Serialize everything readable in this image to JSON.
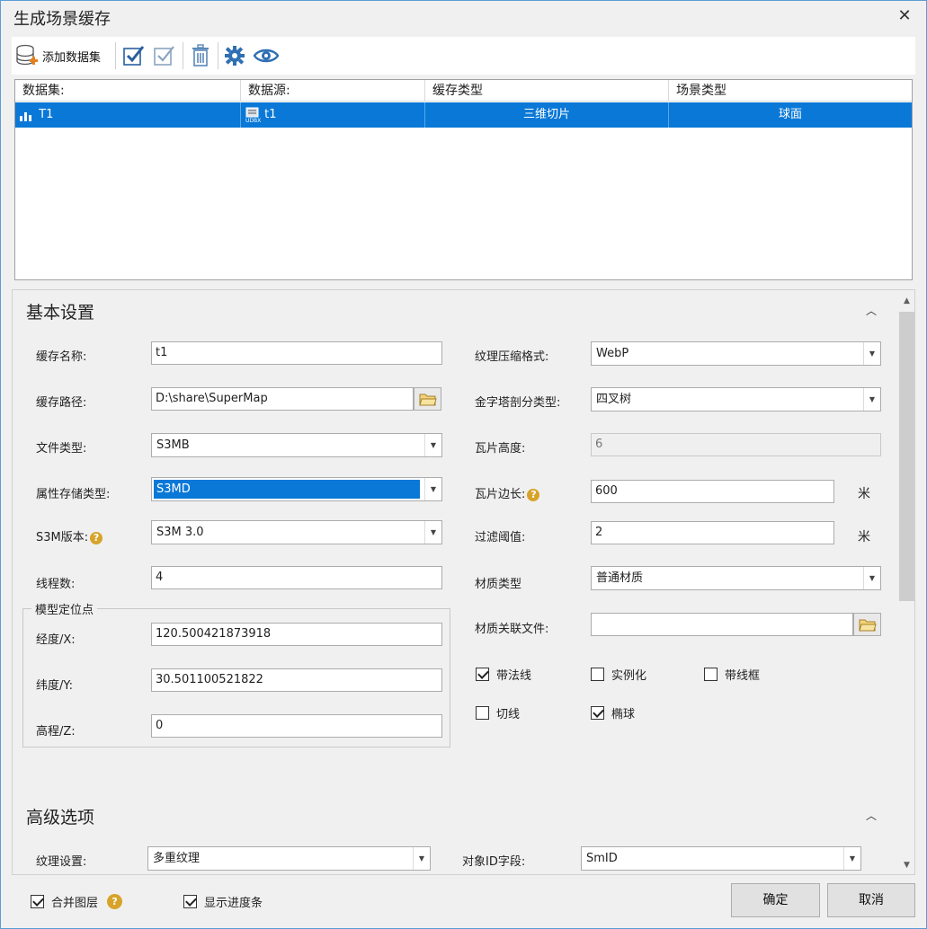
{
  "window": {
    "title": "生成场景缓存"
  },
  "toolbar": {
    "add_dataset_label": "添加数据集"
  },
  "grid": {
    "columns": [
      "数据集:",
      "数据源:",
      "缓存类型",
      "场景类型"
    ],
    "rows": [
      {
        "dataset": "T1",
        "datasource": "t1",
        "cache_type": "三维切片",
        "scene_type": "球面"
      }
    ]
  },
  "basic": {
    "title": "基本设置",
    "cache_name_label": "缓存名称:",
    "cache_name": "t1",
    "cache_path_label": "缓存路径:",
    "cache_path": "D:\\share\\SuperMap",
    "file_type_label": "文件类型:",
    "file_type": "S3MB",
    "attr_storage_label": "属性存储类型:",
    "attr_storage": "S3MD",
    "s3m_version_label": "S3M版本:",
    "s3m_version": "S3M 3.0",
    "threads_label": "线程数:",
    "threads": "4",
    "model_anchor": {
      "title": "模型定位点",
      "lon_label": "经度/X:",
      "lon": "120.500421873918",
      "lat_label": "纬度/Y:",
      "lat": "30.501100521822",
      "elev_label": "高程/Z:",
      "elev": "0"
    },
    "texture_compress_label": "纹理压缩格式:",
    "texture_compress": "WebP",
    "pyramid_label": "金字塔剖分类型:",
    "pyramid": "四叉树",
    "tile_height_label": "瓦片高度:",
    "tile_height": "6",
    "tile_edge_label": "瓦片边长:",
    "tile_edge": "600",
    "filter_label": "过滤阈值:",
    "filter": "2",
    "unit_m": "米",
    "material_type_label": "材质类型",
    "material_type": "普通材质",
    "material_file_label": "材质关联文件:",
    "material_file": "",
    "checks": {
      "normals": "带法线",
      "instancing": "实例化",
      "wireframe": "带线框",
      "tangent": "切线",
      "ellipsoid": "椭球"
    }
  },
  "advanced": {
    "title": "高级选项",
    "texture_label": "纹理设置:",
    "texture": "多重纹理",
    "object_id_label": "对象ID字段:",
    "object_id": "SmID"
  },
  "footer": {
    "merge_layers": "合并图层",
    "show_progress": "显示进度条",
    "ok": "确定",
    "cancel": "取消"
  }
}
